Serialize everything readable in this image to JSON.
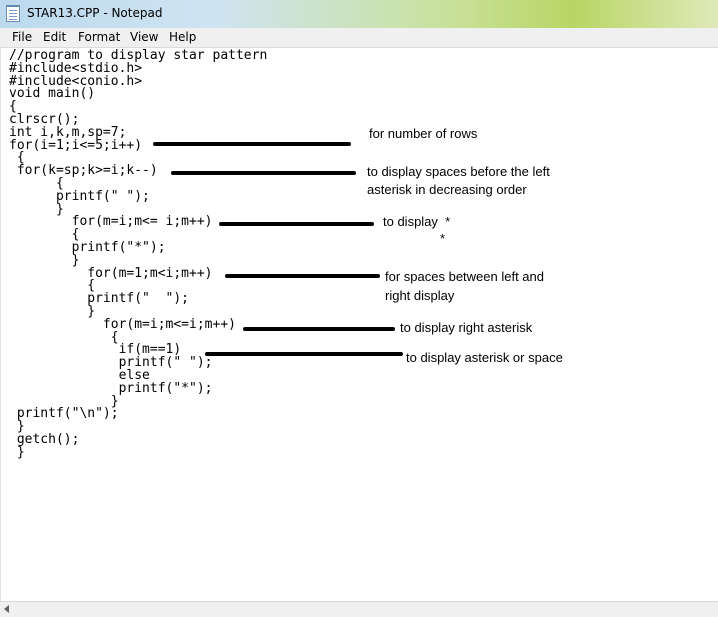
{
  "window": {
    "title": "STAR13.CPP - Notepad",
    "icon": "notepad-icon"
  },
  "menu": [
    "File",
    "Edit",
    "Format",
    "View",
    "Help"
  ],
  "code_lines": [
    "//program to display star pattern",
    "#include<stdio.h>",
    "#include<conio.h>",
    "void main()",
    "{",
    "clrscr();",
    "int i,k,m,sp=7;",
    "for(i=1;i<=5;i++)",
    " {",
    " for(k=sp;k>=i;k--)",
    "      {",
    "      printf(\" \");",
    "      }",
    "        for(m=i;m<= i;m++)",
    "        {",
    "        printf(\"*\");",
    "        }",
    "          for(m=1;m<i;m++)",
    "          {",
    "          printf(\"  \");",
    "          }",
    "            for(m=i;m<=i;m++)",
    "             {",
    "              if(m==1)",
    "              printf(\" \");",
    "              else",
    "              printf(\"*\");",
    "",
    "             }",
    "",
    " printf(\"\\n\");",
    " }",
    " getch();",
    " }"
  ],
  "annotations": [
    "for number of rows",
    "to display spaces before the left",
    "asterisk in decreasing order",
    "to display  *",
    "*",
    "for spaces between left and",
    "right display",
    "to display right asterisk",
    "to display asterisk or space"
  ]
}
